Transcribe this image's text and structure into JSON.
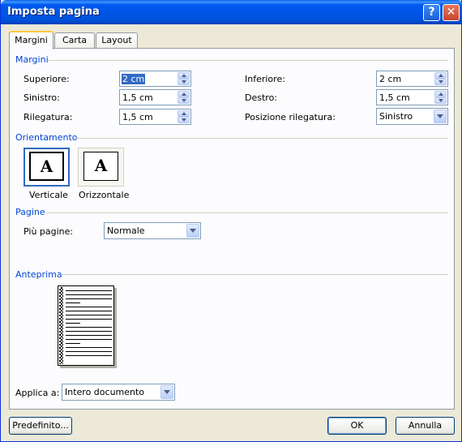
{
  "window": {
    "title": "Imposta pagina",
    "help_glyph": "?",
    "close_glyph": "✕"
  },
  "tabs": [
    {
      "label": "Margini",
      "active": true
    },
    {
      "label": "Carta",
      "active": false
    },
    {
      "label": "Layout",
      "active": false
    }
  ],
  "margins": {
    "section_title": "Margini",
    "superiore": {
      "label": "Superiore:",
      "value": "2 cm"
    },
    "inferiore": {
      "label": "Inferiore:",
      "value": "2 cm"
    },
    "sinistro": {
      "label": "Sinistro:",
      "value": "1,5 cm"
    },
    "destro": {
      "label": "Destro:",
      "value": "1,5 cm"
    },
    "rilegatura": {
      "label": "Rilegatura:",
      "value": "1,5 cm"
    },
    "posizione_rilegatura": {
      "label": "Posizione rilegatura:",
      "value": "Sinistro"
    }
  },
  "orientation": {
    "section_title": "Orientamento",
    "portrait": {
      "label": "Verticale",
      "glyph": "A",
      "selected": true
    },
    "landscape": {
      "label": "Orizzontale",
      "glyph": "A",
      "selected": false
    }
  },
  "pages": {
    "section_title": "Pagine",
    "multiple_label": "Più pagine:",
    "multiple_value": "Normale"
  },
  "preview": {
    "section_title": "Anteprima"
  },
  "apply": {
    "label": "Applica a:",
    "value": "Intero documento"
  },
  "buttons": {
    "default": "Predefinito...",
    "ok": "OK",
    "cancel": "Annulla"
  },
  "colors": {
    "section_text": "#0046D5",
    "title_bar": "#0055E5",
    "selection": "#316AC5"
  }
}
